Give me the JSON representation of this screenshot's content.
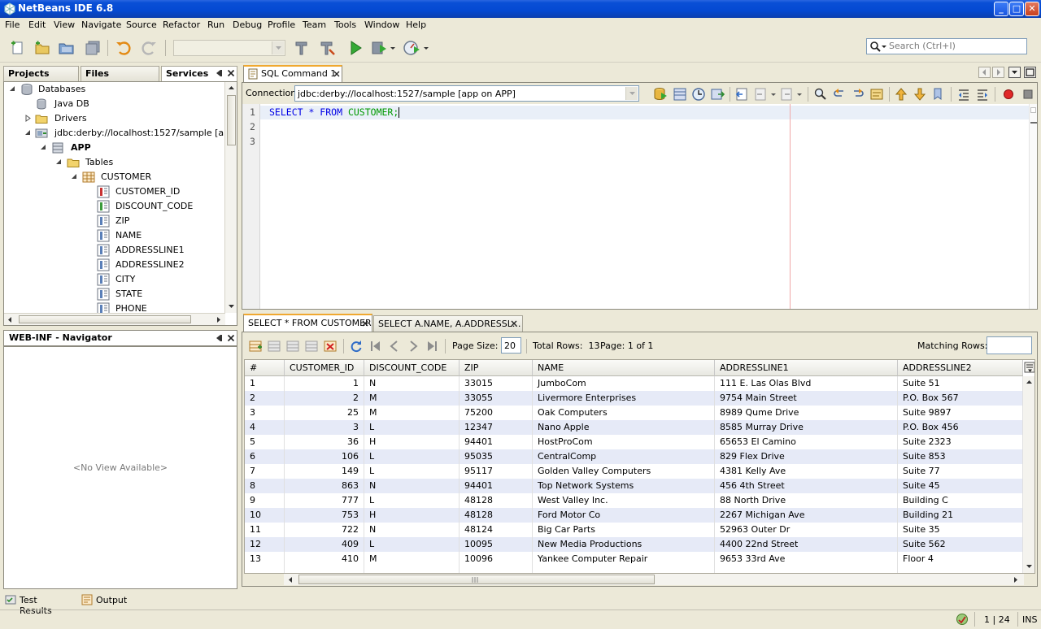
{
  "window": {
    "title": "NetBeans IDE 6.8",
    "min": "_",
    "max": "□",
    "close": "✕"
  },
  "menu": [
    "File",
    "Edit",
    "View",
    "Navigate",
    "Source",
    "Refactor",
    "Run",
    "Debug",
    "Profile",
    "Team",
    "Tools",
    "Window",
    "Help"
  ],
  "search": {
    "placeholder": "Search (Ctrl+I)"
  },
  "left_panel": {
    "tabs": [
      "Projects",
      "Files",
      "Services"
    ],
    "active_tab": "Services",
    "tree": {
      "databases": "Databases",
      "javadb": "Java DB",
      "drivers": "Drivers",
      "connection": "jdbc:derby://localhost:1527/sample [app on APP]",
      "schema": "APP",
      "tables": "Tables",
      "table": "CUSTOMER",
      "columns": [
        "CUSTOMER_ID",
        "DISCOUNT_CODE",
        "ZIP",
        "NAME",
        "ADDRESSLINE1",
        "ADDRESSLINE2",
        "CITY",
        "STATE",
        "PHONE"
      ]
    }
  },
  "navigator": {
    "title": "WEB-INF - Navigator",
    "empty": "<No View Available>"
  },
  "editor": {
    "tab": "SQL Command 1",
    "connection_label": "Connection:",
    "connection_value": "jdbc:derby://localhost:1527/sample [app on APP]",
    "line_numbers": [
      "1",
      "2",
      "3"
    ],
    "sql_keywords": "SELECT * FROM",
    "sql_table": "CUSTOMER;"
  },
  "results": {
    "tabs": [
      "SELECT * FROM CUSTOMER",
      "SELECT A.NAME, A.ADDRESSL..."
    ],
    "page_size_label": "Page Size:",
    "page_size": "20",
    "total_rows": "Total Rows:  13",
    "page": "Page: 1 of 1",
    "matching_rows_label": "Matching Rows:",
    "columns": [
      "#",
      "CUSTOMER_ID",
      "DISCOUNT_CODE",
      "ZIP",
      "NAME",
      "ADDRESSLINE1",
      "ADDRESSLINE2"
    ],
    "rows": [
      [
        "1",
        "1",
        "N",
        "33015",
        "JumboCom",
        "111 E. Las Olas Blvd",
        "Suite 51"
      ],
      [
        "2",
        "2",
        "M",
        "33055",
        "Livermore Enterprises",
        "9754 Main Street",
        "P.O. Box 567"
      ],
      [
        "3",
        "25",
        "M",
        "75200",
        "Oak Computers",
        "8989 Qume Drive",
        "Suite 9897"
      ],
      [
        "4",
        "3",
        "L",
        "12347",
        "Nano Apple",
        "8585 Murray Drive",
        "P.O. Box 456"
      ],
      [
        "5",
        "36",
        "H",
        "94401",
        "HostProCom",
        "65653 El Camino",
        "Suite 2323"
      ],
      [
        "6",
        "106",
        "L",
        "95035",
        "CentralComp",
        "829 Flex Drive",
        "Suite 853"
      ],
      [
        "7",
        "149",
        "L",
        "95117",
        "Golden Valley Computers",
        "4381 Kelly Ave",
        "Suite 77"
      ],
      [
        "8",
        "863",
        "N",
        "94401",
        "Top Network Systems",
        "456 4th Street",
        "Suite 45"
      ],
      [
        "9",
        "777",
        "L",
        "48128",
        "West Valley Inc.",
        "88 North Drive",
        "Building C"
      ],
      [
        "10",
        "753",
        "H",
        "48128",
        "Ford Motor Co",
        "2267 Michigan Ave",
        "Building 21"
      ],
      [
        "11",
        "722",
        "N",
        "48124",
        "Big Car Parts",
        "52963 Outer Dr",
        "Suite 35"
      ],
      [
        "12",
        "409",
        "L",
        "10095",
        "New Media Productions",
        "4400 22nd Street",
        "Suite 562"
      ],
      [
        "13",
        "410",
        "M",
        "10096",
        "Yankee Computer Repair",
        "9653 33rd Ave",
        "Floor 4"
      ]
    ]
  },
  "bottom_tabs": [
    "Test Results",
    "Output"
  ],
  "status": {
    "position": "1 | 24",
    "mode": "INS"
  }
}
